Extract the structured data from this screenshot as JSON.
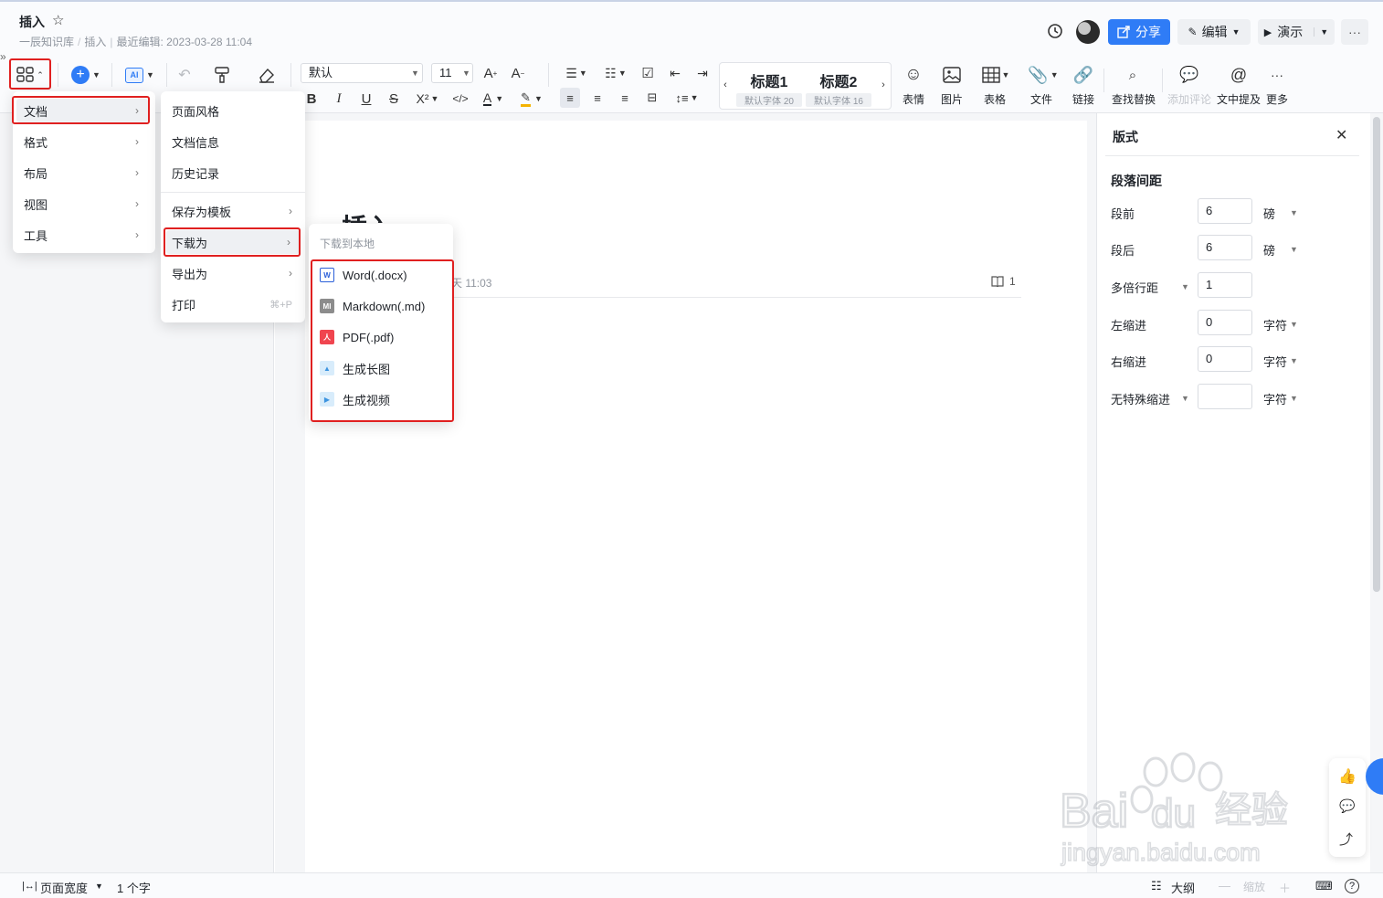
{
  "header": {
    "doc_title": "插入",
    "breadcrumb": [
      "一辰知识库",
      "插入"
    ],
    "last_edit": "最近编辑: 2023-03-28 11:04",
    "share_label": "分享",
    "edit_label": "编辑",
    "present_label": "演示",
    "more_label": "···"
  },
  "toolbar": {
    "font_family": "默认",
    "font_size": "11",
    "heading1": {
      "label": "标题1",
      "sub": "默认字体 20"
    },
    "heading2": {
      "label": "标题2",
      "sub": "默认字体 16"
    },
    "items": {
      "emoji": "表情",
      "image": "图片",
      "table": "表格",
      "file": "文件",
      "link": "链接",
      "find_replace": "查找替换",
      "add_comment": "添加评论",
      "mention": "文中提及",
      "more": "更多"
    },
    "text_btns": {
      "bold": "B",
      "italic": "I",
      "underline": "U",
      "strike": "S",
      "superscript": "X²",
      "code": "</>",
      "font_color": "A",
      "highlight": "✎"
    }
  },
  "main_menu": {
    "items": [
      {
        "label": "文档"
      },
      {
        "label": "格式"
      },
      {
        "label": "布局"
      },
      {
        "label": "视图"
      },
      {
        "label": "工具"
      }
    ]
  },
  "doc_submenu": {
    "items": [
      {
        "label": "页面风格"
      },
      {
        "label": "文档信息"
      },
      {
        "label": "历史记录"
      },
      {
        "label": "保存为模板"
      },
      {
        "label": "下载为"
      },
      {
        "label": "导出为"
      },
      {
        "label": "打印",
        "shortcut": "⌘+P"
      }
    ]
  },
  "download_submenu": {
    "header": "下载到本地",
    "items": [
      {
        "label": "Word(.docx)",
        "icon": "word-icon",
        "badge": "W",
        "color": "#2b5fd9"
      },
      {
        "label": "Markdown(.md)",
        "icon": "markdown-icon",
        "badge": "MI",
        "color": "#8c8c8c"
      },
      {
        "label": "PDF(.pdf)",
        "icon": "pdf-icon",
        "badge": "人",
        "color": "#f0454f"
      },
      {
        "label": "生成长图",
        "icon": "long-image-icon",
        "badge": "▲",
        "color": "#7ec0f2"
      },
      {
        "label": "生成视频",
        "icon": "video-icon",
        "badge": "▶",
        "color": "#7ec0f2"
      }
    ]
  },
  "document": {
    "title": "插入",
    "meta_time": "天 11:03",
    "read_count": "1"
  },
  "right_panel": {
    "title": "版式",
    "section": "段落间距",
    "rows": [
      {
        "label": "段前",
        "value": "6",
        "unit": "磅"
      },
      {
        "label": "段后",
        "value": "6",
        "unit": "磅"
      },
      {
        "label": "多倍行距",
        "value": "1",
        "unit": ""
      },
      {
        "label": "左缩进",
        "value": "0",
        "unit": "字符"
      },
      {
        "label": "右缩进",
        "value": "0",
        "unit": "字符"
      },
      {
        "label": "无特殊缩进",
        "value": "",
        "unit": "字符"
      }
    ]
  },
  "footer": {
    "page_width": "页面宽度",
    "word_count": "1 个字",
    "outline": "大纲",
    "zoom": "缩放"
  },
  "watermark": {
    "brand": "Baidu经验",
    "url": "jingyan.baidu.com"
  },
  "colors": {
    "accent": "#2f7cf6",
    "highlight_box": "#e02020"
  }
}
